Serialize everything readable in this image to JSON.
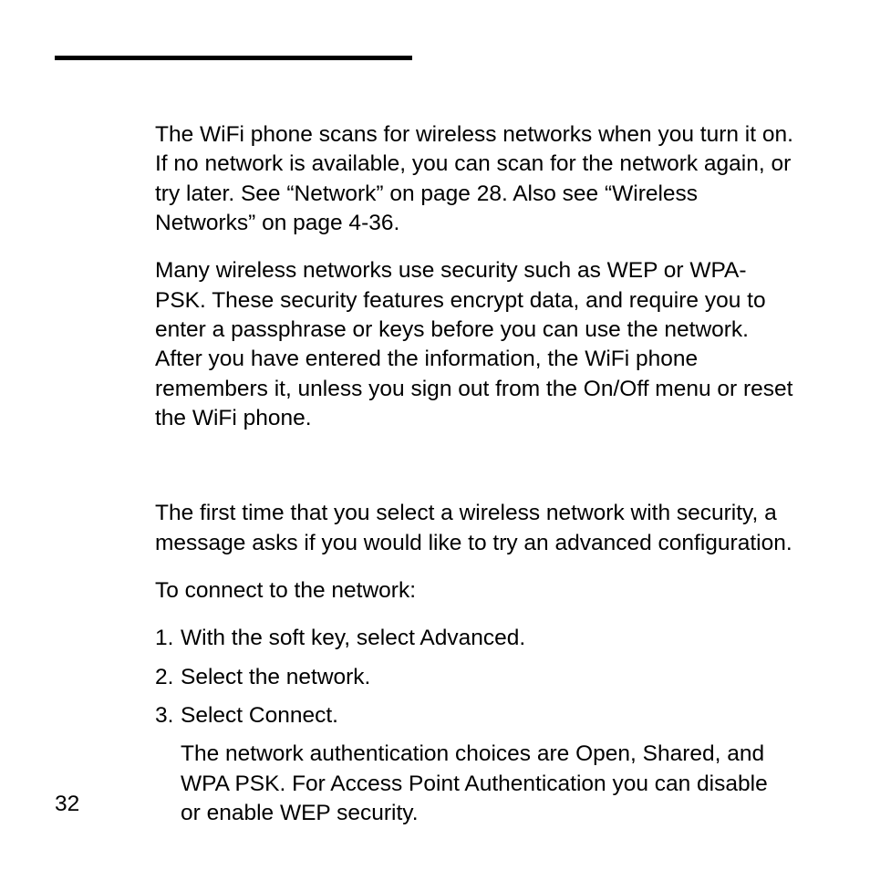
{
  "body": {
    "para1": "The WiFi phone scans for wireless networks when you turn it on. If no network is available, you can scan for the network again, or try later. See “Network” on page 28. Also see “Wireless Networks” on page 4-36.",
    "para2": "Many wireless networks use security such as WEP or WPA-PSK. These security features encrypt data, and require you to enter a passphrase or keys before you can use the network. After you have entered the information, the WiFi phone remembers it, unless you sign out from the On/Off menu or reset the WiFi phone.",
    "para3": "The first time that you select a wireless network with security, a message asks if you would like to try an advanced configuration.",
    "para4": "To connect to the network:",
    "steps": [
      {
        "num": "1.",
        "text": "With the soft key, select Advanced."
      },
      {
        "num": "2.",
        "text": "Select the network."
      },
      {
        "num": "3.",
        "text": "Select Connect."
      }
    ],
    "step3_desc": "The network authentication choices are Open, Shared, and WPA PSK. For Access Point Authentication you can disable or enable WEP security."
  },
  "page_number": "32"
}
